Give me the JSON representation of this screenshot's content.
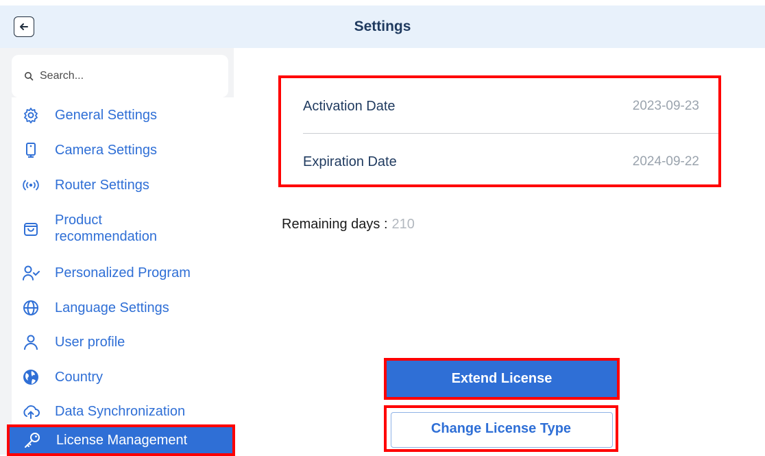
{
  "header": {
    "title": "Settings",
    "back_icon": "arrow-left-icon"
  },
  "sidebar": {
    "search_placeholder": "Search...",
    "items": [
      {
        "label": "General Settings",
        "icon": "gear-icon"
      },
      {
        "label": "Camera Settings",
        "icon": "camera-device-icon"
      },
      {
        "label": "Router Settings",
        "icon": "broadcast-icon"
      },
      {
        "label": "Product\nrecommendation",
        "icon": "shopping-bag-icon"
      },
      {
        "label": "Personalized Program",
        "icon": "user-check-icon"
      },
      {
        "label": "Language Settings",
        "icon": "globe-icon"
      },
      {
        "label": "User profile",
        "icon": "user-icon"
      },
      {
        "label": "Country",
        "icon": "earth-icon"
      },
      {
        "label": "Data Synchronization",
        "icon": "cloud-upload-icon"
      },
      {
        "label": "License Management",
        "icon": "key-icon",
        "active": true
      }
    ]
  },
  "license": {
    "activation_label": "Activation Date",
    "activation_value": "2023-09-23",
    "expiration_label": "Expiration Date",
    "expiration_value": "2024-09-22",
    "remaining_label": "Remaining days :",
    "remaining_value": "210"
  },
  "actions": {
    "extend_label": "Extend License",
    "change_label": "Change License Type"
  },
  "colors": {
    "accent": "#2f6fd6",
    "highlight": "#ff0000",
    "header_bg": "#e8f1fb"
  }
}
